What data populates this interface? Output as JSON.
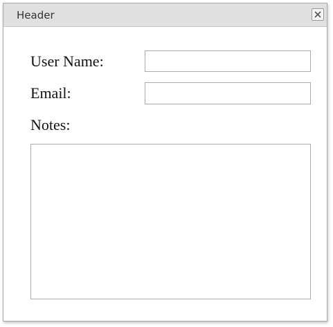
{
  "dialog": {
    "title": "Header"
  },
  "form": {
    "username_label": "User Name:",
    "username_value": "",
    "email_label": "Email:",
    "email_value": "",
    "notes_label": "Notes:",
    "notes_value": ""
  },
  "icons": {
    "close": "close-icon"
  }
}
